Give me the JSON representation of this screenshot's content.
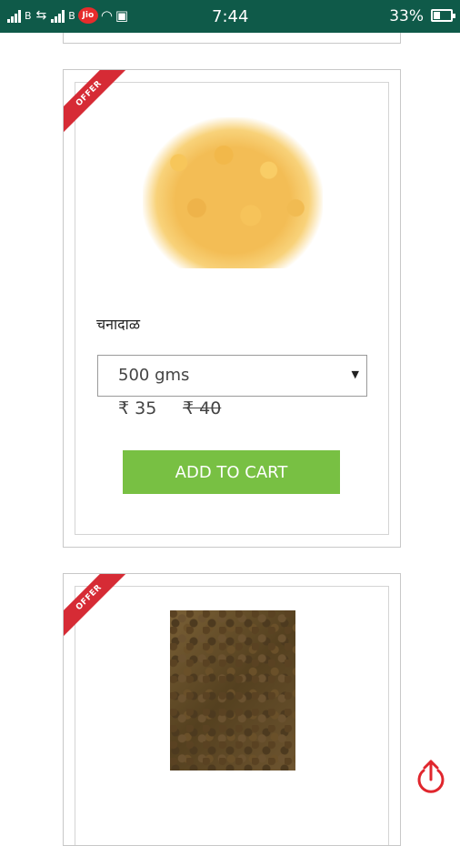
{
  "status_bar": {
    "carrier_badge": "Jio",
    "time": "7:44",
    "battery": "33%"
  },
  "products": [
    {
      "badge": "OFFER",
      "image": "chana-dal-image",
      "name": "चनादाळ",
      "weight": "500 gms",
      "price": "₹ 35",
      "mrp": "₹ 40",
      "cta": "ADD TO CART"
    },
    {
      "badge": "OFFER",
      "image": "brown-lentils-image"
    }
  ],
  "colors": {
    "status_bar": "#0f5a49",
    "offer_ribbon": "#d62b35",
    "cta": "#78c043",
    "share_icon": "#e0262d"
  },
  "icons": [
    "signal-icon",
    "data-transfer-icon",
    "wifi-icon",
    "image-icon",
    "battery-icon",
    "share-icon"
  ]
}
